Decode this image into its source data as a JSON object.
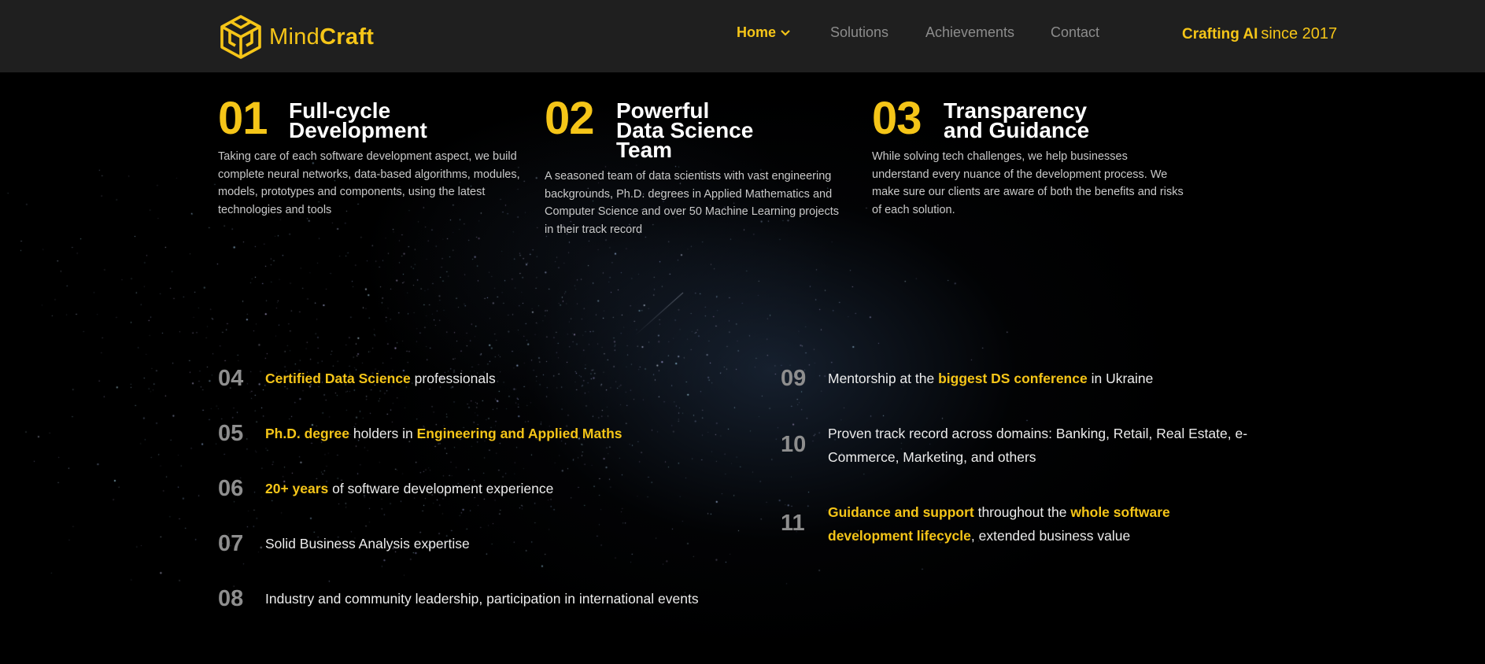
{
  "brand": {
    "name_light": "Mind",
    "name_bold": "Craft",
    "tagline_strong": "Crafting AI",
    "tagline_light": "since 2017",
    "accent_color": "#f5c518",
    "logo_icon": "mindcraft-cube-logo"
  },
  "nav": {
    "items": [
      {
        "label": "Home",
        "active": true,
        "icon": "chevron-down-icon"
      },
      {
        "label": "Solutions",
        "active": false
      },
      {
        "label": "Achievements",
        "active": false
      },
      {
        "label": "Contact",
        "active": false
      }
    ]
  },
  "features": [
    {
      "number": "01",
      "title": "Full-cycle\nDevelopment",
      "description": "Taking care of each software development aspect, we build complete neural networks, data-based algorithms, modules, models, prototypes and components, using the latest technologies and tools"
    },
    {
      "number": "02",
      "title": "Powerful\nData Science\nTeam",
      "description": "A seasoned team of data scientists with vast engineering backgrounds, Ph.D. degrees in Applied Mathematics and Computer Science and over 50 Machine Learning projects in their track record"
    },
    {
      "number": "03",
      "title": "Transparency\nand Guidance",
      "description": "While solving tech challenges, we help businesses understand every nuance of the development process. We make sure our clients are aware of both the benefits and risks of each solution."
    }
  ],
  "list": [
    {
      "number": "04",
      "parts": [
        {
          "text": "Certified Data Science",
          "hl": true
        },
        {
          "text": " professionals",
          "hl": false
        }
      ]
    },
    {
      "number": "05",
      "parts": [
        {
          "text": "Ph.D. degree",
          "hl": true
        },
        {
          "text": " holders in ",
          "hl": false
        },
        {
          "text": "Engineering and Applied Maths",
          "hl": true
        }
      ]
    },
    {
      "number": "06",
      "parts": [
        {
          "text": "20+ years",
          "hl": true
        },
        {
          "text": " of software development experience",
          "hl": false
        }
      ]
    },
    {
      "number": "07",
      "parts": [
        {
          "text": "Solid Business Analysis expertise",
          "hl": false
        }
      ]
    },
    {
      "number": "08",
      "parts": [
        {
          "text": "Industry and community leadership, participation in international events",
          "hl": false
        }
      ]
    },
    {
      "number": "09",
      "parts": [
        {
          "text": "Mentorship at the ",
          "hl": false
        },
        {
          "text": "biggest DS conference",
          "hl": true
        },
        {
          "text": " in Ukraine",
          "hl": false
        }
      ]
    },
    {
      "number": "10",
      "parts": [
        {
          "text": "Proven track record across domains: Banking, Retail, Real Estate, e-Commerce, Marketing, and others",
          "hl": false
        }
      ]
    },
    {
      "number": "11",
      "parts": [
        {
          "text": "Guidance and support",
          "hl": true
        },
        {
          "text": " throughout the ",
          "hl": false
        },
        {
          "text": "whole software development lifecycle",
          "hl": true
        },
        {
          "text": ", extended business value",
          "hl": false
        }
      ]
    }
  ]
}
